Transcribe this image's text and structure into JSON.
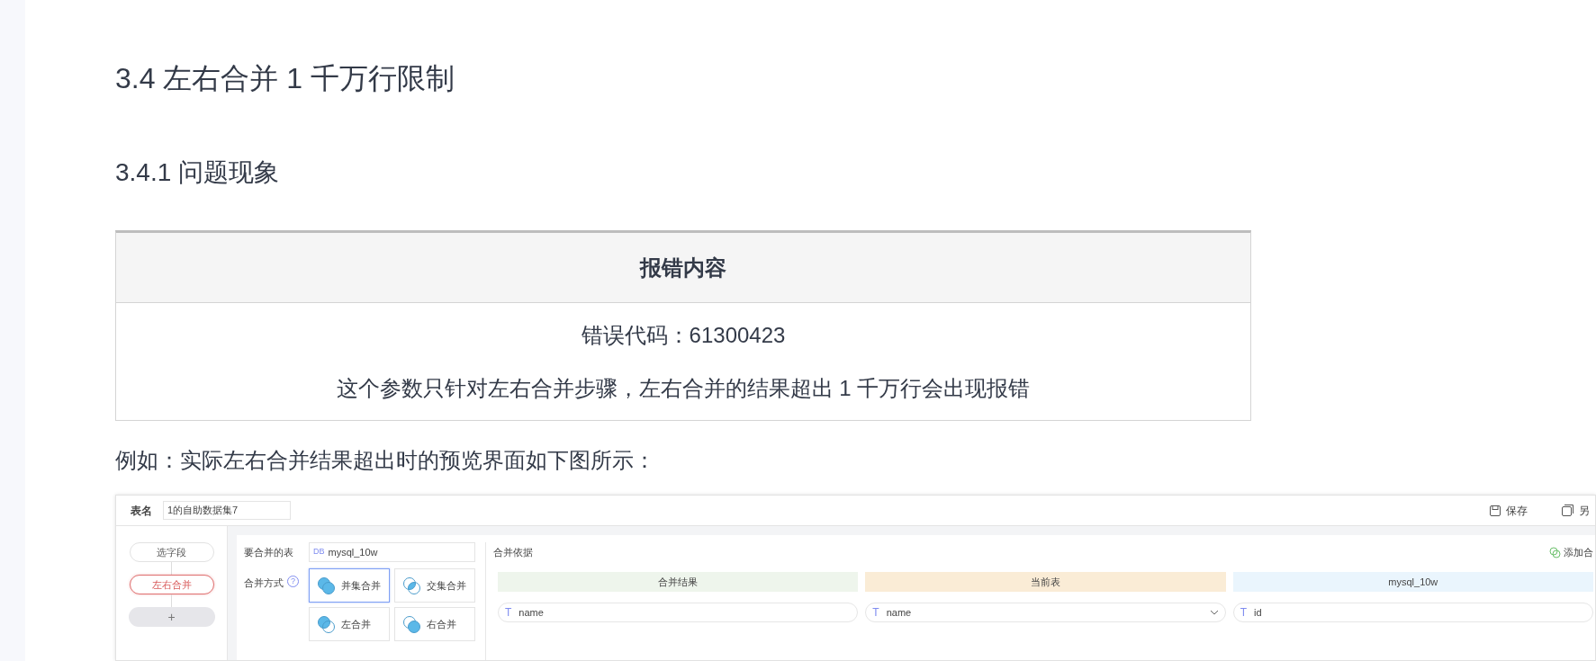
{
  "heading": "3.4 左右合并 1 千万行限制",
  "subheading": "3.4.1 问题现象",
  "error_table": {
    "header": "报错内容",
    "lines": [
      "错误代码：61300423",
      "这个参数只针对左右合并步骤，左右合并的结果超出 1 千万行会出现报错"
    ]
  },
  "paragraph": "例如：实际左右合并结果超出时的预览界面如下图所示：",
  "screenshot": {
    "toolbar": {
      "name_label": "表名",
      "name_value": "1的自助数据集7",
      "actions": [
        {
          "label": "保存",
          "kind": "save"
        },
        {
          "label": "另",
          "kind": "save_as"
        }
      ]
    },
    "steps": [
      {
        "label": "选字段",
        "selected": false
      },
      {
        "label": "左右合并",
        "selected": true
      }
    ],
    "add_step": "+",
    "table_label": "要合并的表",
    "table_badge": "DB",
    "table_value": "mysql_10w",
    "method_label": "合并方式",
    "help": "?",
    "methods": [
      {
        "label": "并集合并",
        "kind": "union",
        "selected": true
      },
      {
        "label": "交集合并",
        "kind": "intersect",
        "selected": false
      },
      {
        "label": "左合并",
        "kind": "left",
        "selected": false
      },
      {
        "label": "右合并",
        "kind": "right",
        "selected": false
      }
    ],
    "basis_label": "合并依据",
    "add_label": "添加合",
    "columns": [
      {
        "title": "合并结果",
        "color": "#eef5ec",
        "type_mark": "T",
        "field": "name",
        "dropdown": false
      },
      {
        "title": "当前表",
        "color": "#faecd6",
        "type_mark": "T",
        "field": "name",
        "dropdown": true
      },
      {
        "title": "mysql_10w",
        "color": "#eaf5fd",
        "type_mark": "T",
        "field": "id",
        "dropdown": false
      }
    ]
  }
}
